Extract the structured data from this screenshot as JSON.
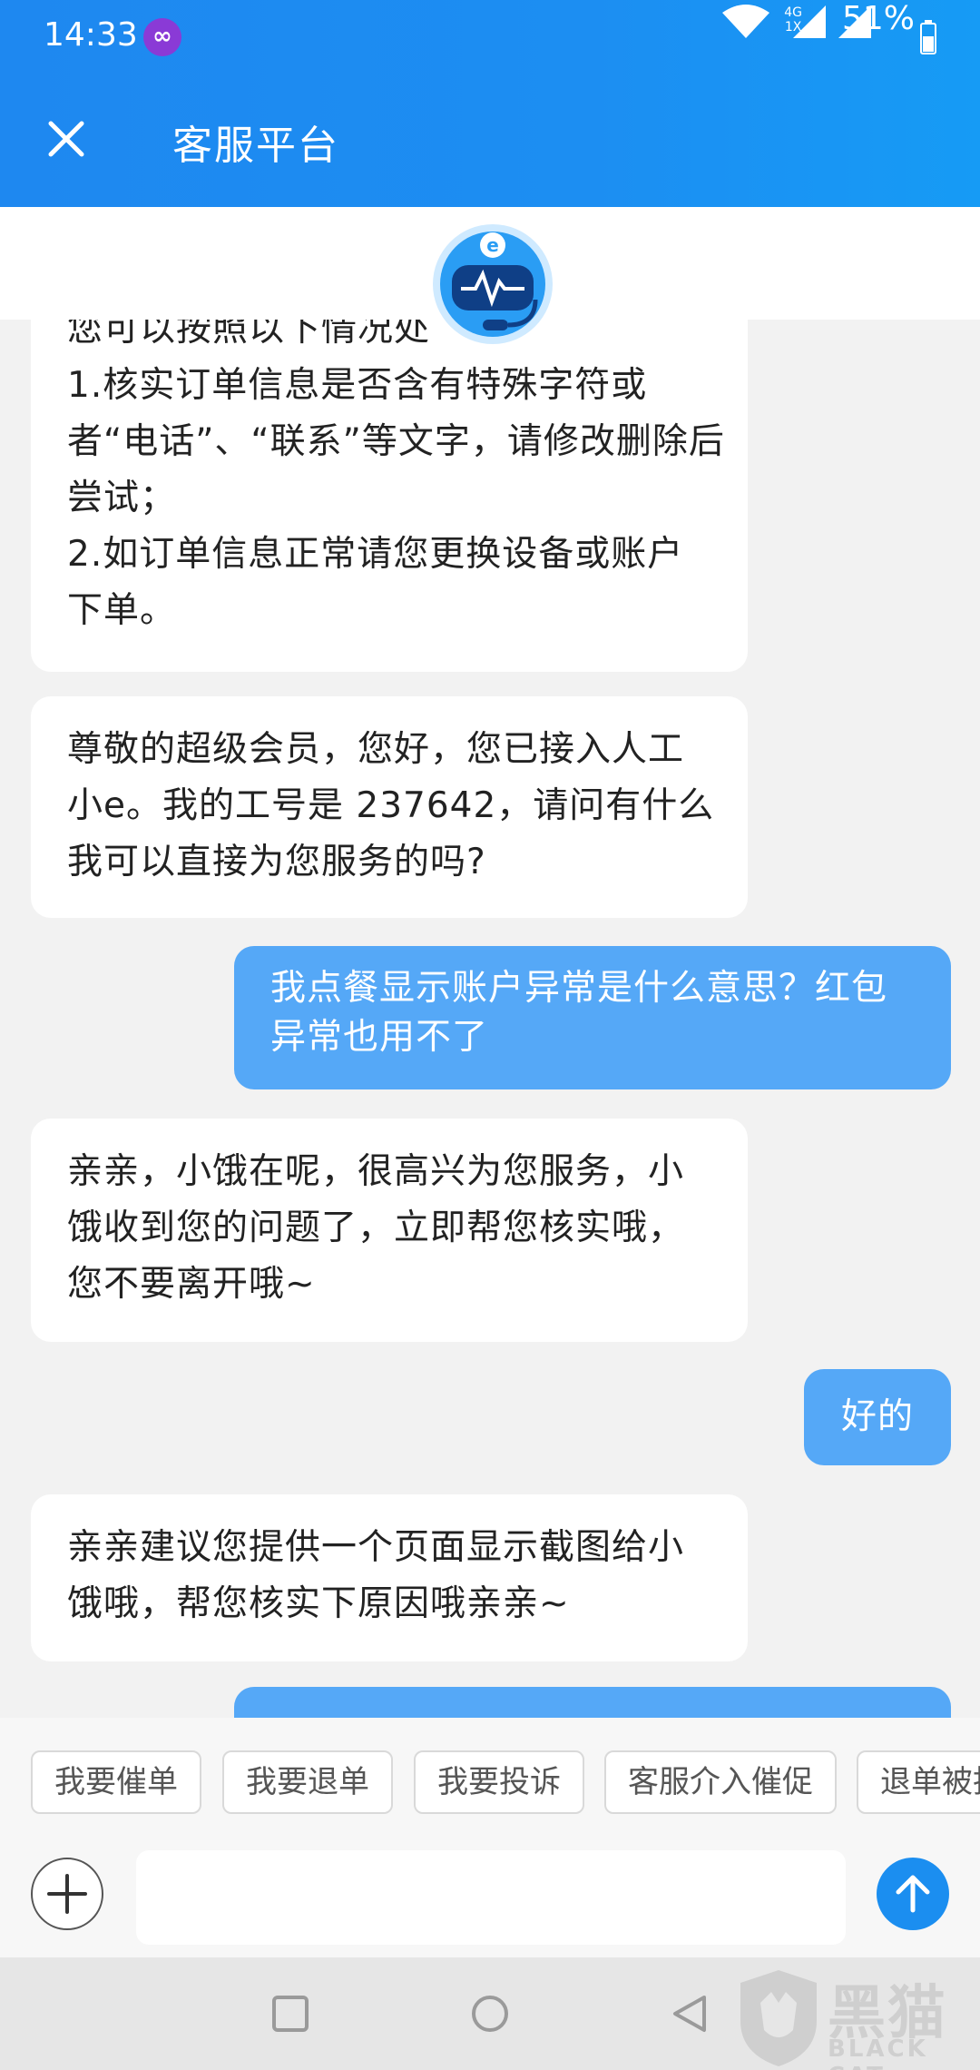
{
  "status_bar": {
    "time": "14:33",
    "network_top": "4G",
    "network_bottom": "1X",
    "battery": "51%"
  },
  "header": {
    "title": "客服平台"
  },
  "messages": [
    {
      "side": "left",
      "lines": [
        "您可以按照以下情况处",
        "1.核实订单信息是否含有特殊字符或",
        "者“电话”、“联系”等文字，请修改删除后",
        "尝试；",
        "2.如订单信息正常请您更换设备或账户",
        "下单。"
      ]
    },
    {
      "side": "left",
      "lines": [
        "尊敬的超级会员，您好，您已接入人工",
        "小e。我的工号是 237642，请问有什么",
        "我可以直接为您服务的吗?"
      ]
    },
    {
      "side": "right",
      "lines": [
        "我点餐显示账户异常是什么意思？红包",
        "异常也用不了"
      ]
    },
    {
      "side": "left",
      "lines": [
        "亲亲，小饿在呢，很高兴为您服务，小",
        "饿收到您的问题了，立即帮您核实哦，",
        "您不要离开哦~"
      ]
    },
    {
      "side": "right",
      "lines": [
        "好的"
      ]
    },
    {
      "side": "left",
      "lines": [
        "亲亲建议您提供一个页面显示截图给小",
        "饿哦，帮您核实下原因哦亲亲~"
      ]
    }
  ],
  "quick_replies": [
    "我要催单",
    "我要退单",
    "我要投诉",
    "客服介入催促",
    "退单被拒"
  ],
  "input": {
    "placeholder": ""
  },
  "watermark": {
    "text": "黑猫",
    "sub": "BLACK CAT"
  },
  "colors": {
    "header": "#1c8ef2",
    "user_bubble": "#55a8f7",
    "send": "#1b8ef0"
  }
}
